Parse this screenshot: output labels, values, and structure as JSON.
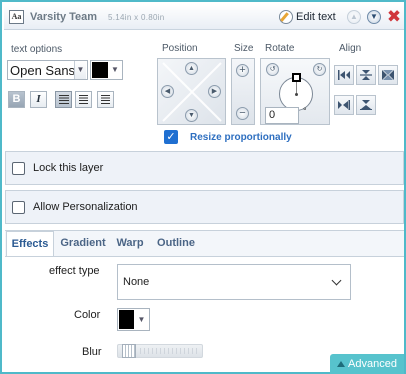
{
  "header": {
    "title": "Varsity Team",
    "dimensions": "5.14in x 0.80in",
    "edit_text_label": "Edit text",
    "close_glyph": "✖"
  },
  "text_options": {
    "label": "text options",
    "font": "Open Sans",
    "text_color": "#000000",
    "bold_label": "B",
    "italic_label": "I"
  },
  "position": {
    "label": "Position"
  },
  "size": {
    "label": "Size",
    "plus": "+",
    "minus": "−"
  },
  "rotate": {
    "label": "Rotate",
    "value": "0",
    "unit": "°"
  },
  "align": {
    "label": "Align"
  },
  "resize": {
    "label": "Resize proportionally",
    "checked": true,
    "check_glyph": "✓"
  },
  "layer": {
    "lock_label": "Lock this layer",
    "personalization_label": "Allow Personalization"
  },
  "tabs": [
    {
      "label": "Effects",
      "active": true
    },
    {
      "label": "Gradient",
      "active": false
    },
    {
      "label": "Warp",
      "active": false
    },
    {
      "label": "Outline",
      "active": false
    }
  ],
  "effects": {
    "effect_type_label": "effect type",
    "effect_type_value": "None",
    "color_label": "Color",
    "color_value": "#000000",
    "blur_label": "Blur",
    "blur_value": 0
  },
  "advanced_label": "Advanced",
  "colors": {
    "accent": "#4fb9c9",
    "advanced_bg": "#57c3cd",
    "checkbox": "#1f6fd1",
    "close": "#d0363c"
  }
}
